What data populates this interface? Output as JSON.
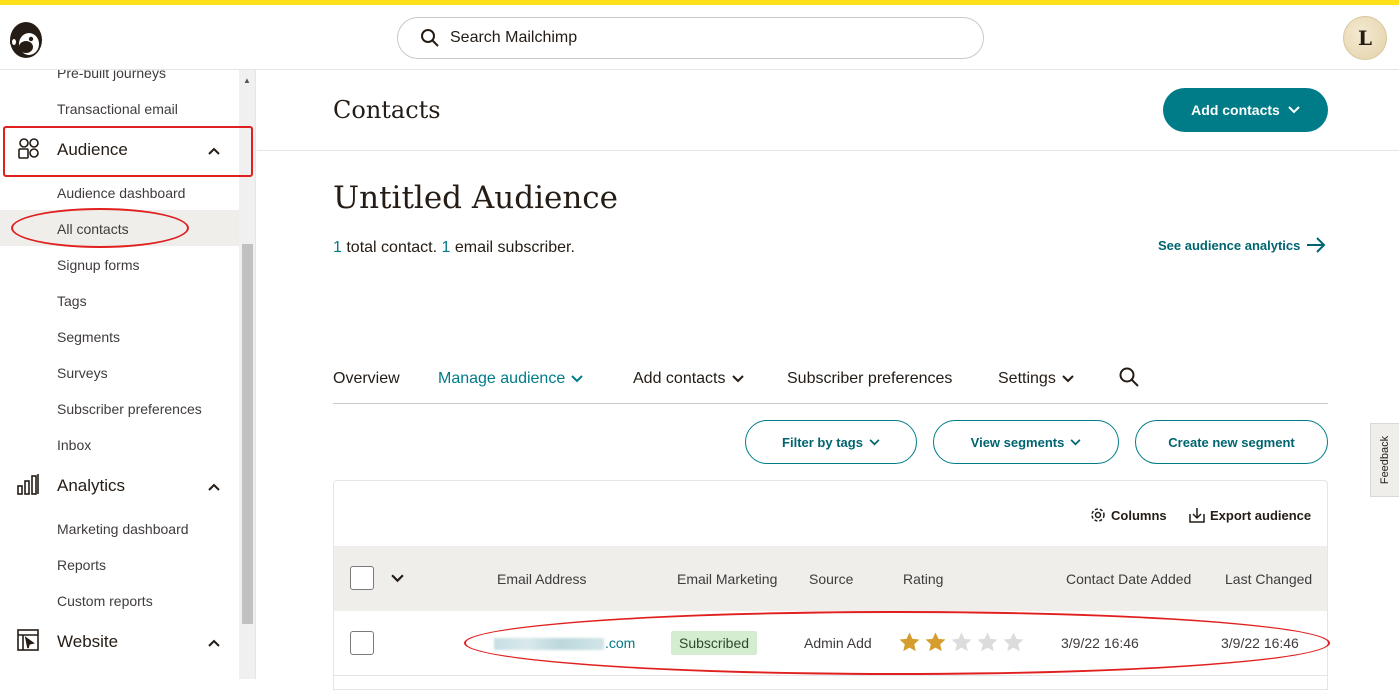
{
  "search": {
    "placeholder": "Search Mailchimp"
  },
  "user": {
    "initial": "L"
  },
  "sidebar": {
    "prev_items": [
      "Pre-built journeys",
      "Transactional email"
    ],
    "audience": {
      "label": "Audience",
      "items": [
        "Audience dashboard",
        "All contacts",
        "Signup forms",
        "Tags",
        "Segments",
        "Surveys",
        "Subscriber preferences",
        "Inbox"
      ]
    },
    "analytics": {
      "label": "Analytics",
      "items": [
        "Marketing dashboard",
        "Reports",
        "Custom reports"
      ]
    },
    "website": {
      "label": "Website"
    }
  },
  "page": {
    "title": "Contacts",
    "add_contacts_label": "Add contacts"
  },
  "audience": {
    "name": "Untitled Audience",
    "total_count": "1",
    "total_text": " total contact. ",
    "email_count": "1",
    "email_text": " email subscriber.",
    "analytics_link": "See audience analytics"
  },
  "tabs": [
    "Overview",
    "Manage audience",
    "Add contacts",
    "Subscriber preferences",
    "Settings"
  ],
  "actions": {
    "filter_tags": "Filter by tags",
    "view_segments": "View segments",
    "create_segment": "Create new segment"
  },
  "table": {
    "tools": {
      "columns": "Columns",
      "export": "Export audience"
    },
    "headers": [
      "Email Address",
      "Email Marketing",
      "Source",
      "Rating",
      "Contact Date Added",
      "Last Changed"
    ],
    "rows": [
      {
        "email_visible": ".com",
        "email_marketing": "Subscribed",
        "source": "Admin Add",
        "rating": 2,
        "rating_max": 5,
        "date_added": "3/9/22 16:46",
        "last_changed": "3/9/22 16:46"
      }
    ]
  },
  "feedback": "Feedback",
  "colors": {
    "brand_teal": "#007c89",
    "yellow": "#ffe01b",
    "annotation_red": "#e0201f",
    "star_filled": "#d49d2d",
    "star_empty": "#dcdcdc"
  }
}
